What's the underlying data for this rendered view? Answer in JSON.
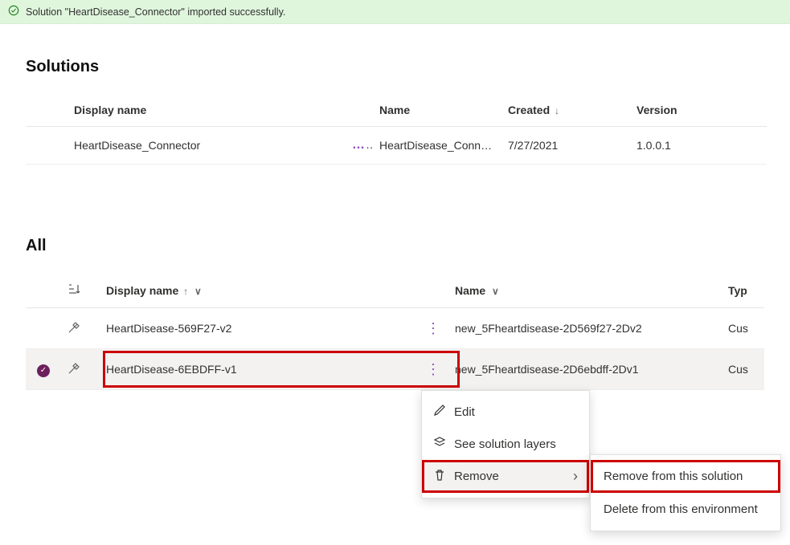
{
  "banner": {
    "message": "Solution \"HeartDisease_Connector\" imported successfully."
  },
  "solutions": {
    "heading": "Solutions",
    "columns": {
      "display_name": "Display name",
      "name": "Name",
      "created": "Created",
      "version": "Version"
    },
    "row": {
      "display_name": "HeartDisease_Connector",
      "name": "HeartDisease_Conne...",
      "created": "7/27/2021",
      "version": "1.0.0.1"
    }
  },
  "all": {
    "heading": "All",
    "columns": {
      "display_name": "Display name",
      "name": "Name",
      "type": "Typ"
    },
    "rows": [
      {
        "display_name": "HeartDisease-569F27-v2",
        "name": "new_5Fheartdisease-2D569f27-2Dv2",
        "type": "Cus",
        "selected": false
      },
      {
        "display_name": "HeartDisease-6EBDFF-v1",
        "name": "new_5Fheartdisease-2D6ebdff-2Dv1",
        "type": "Cus",
        "selected": true
      }
    ]
  },
  "context_menu": {
    "edit": "Edit",
    "layers": "See solution layers",
    "remove": "Remove"
  },
  "submenu": {
    "remove_solution": "Remove from this solution",
    "delete_env": "Delete from this environment"
  }
}
